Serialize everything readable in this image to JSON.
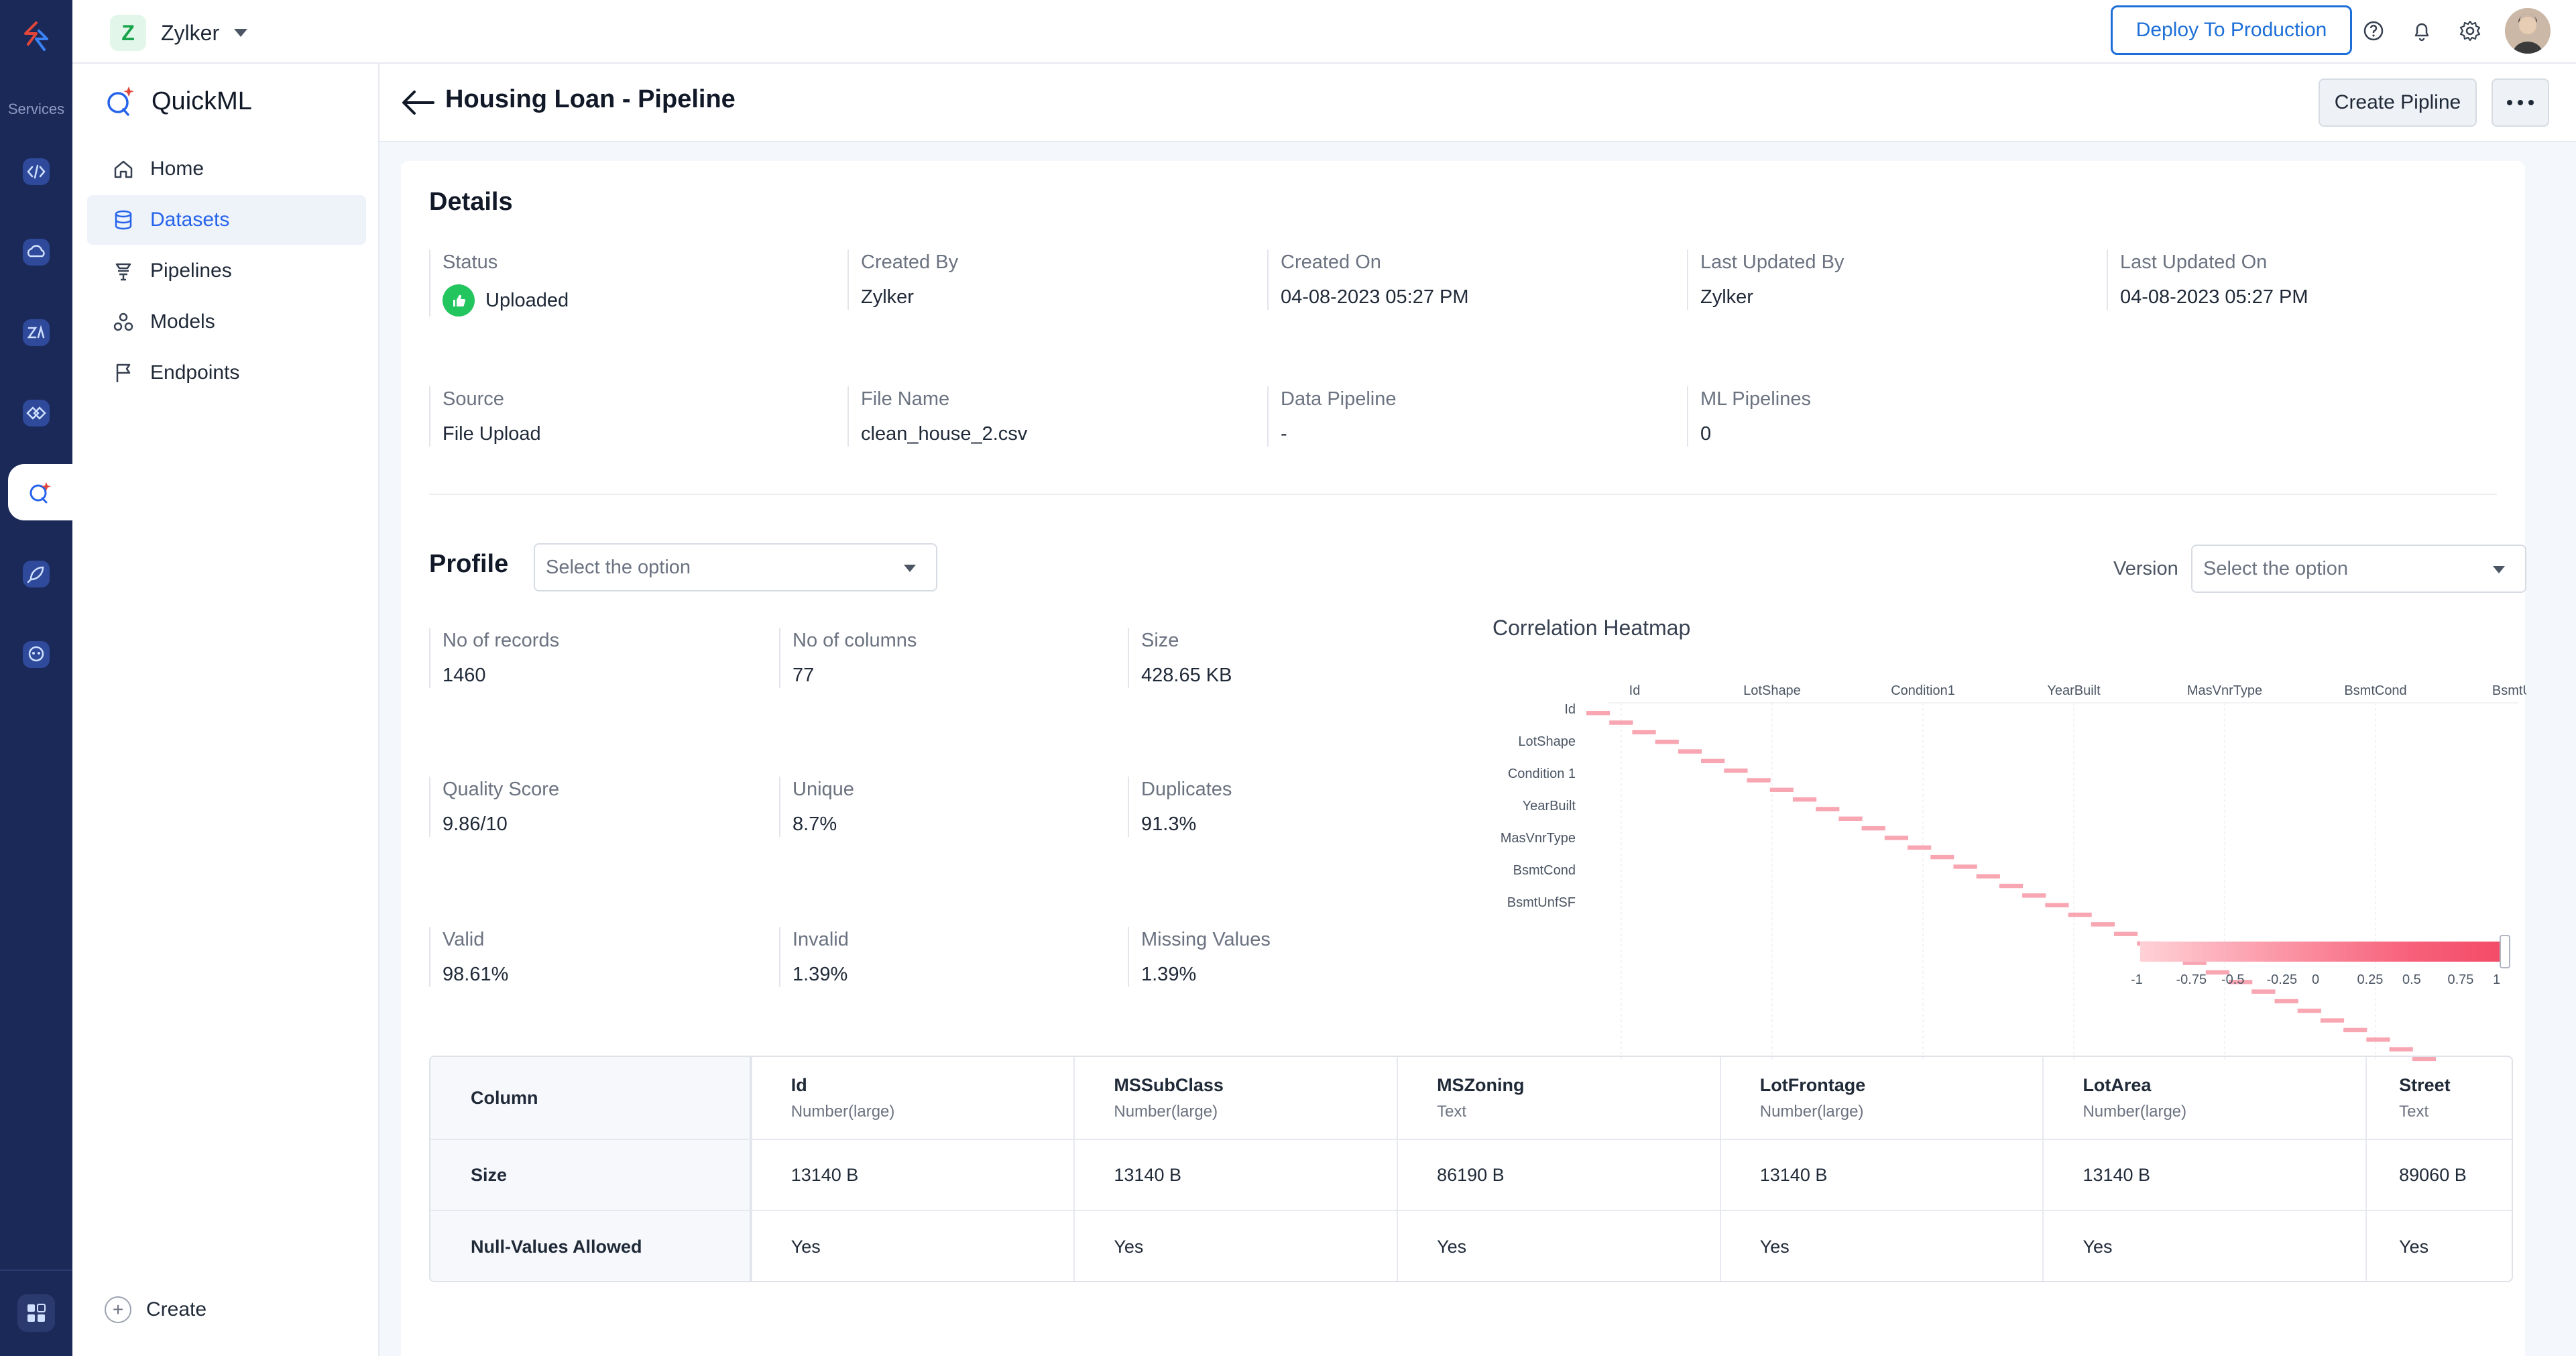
{
  "topbar": {
    "org_initial": "Z",
    "org_name": "Zylker",
    "deploy_label": "Deploy To Production"
  },
  "rail": {
    "services_label": "Services"
  },
  "nav": {
    "brand": "QuickML",
    "items": [
      {
        "label": "Home",
        "icon": "home-icon"
      },
      {
        "label": "Datasets",
        "icon": "database-icon"
      },
      {
        "label": "Pipelines",
        "icon": "pipeline-icon"
      },
      {
        "label": "Models",
        "icon": "models-icon"
      },
      {
        "label": "Endpoints",
        "icon": "flag-icon"
      }
    ],
    "create_label": "Create"
  },
  "page": {
    "title": "Housing Loan - Pipeline",
    "create_pipeline_label": "Create Pipline"
  },
  "details": {
    "heading": "Details",
    "status_label": "Status",
    "status_value": "Uploaded",
    "created_by_label": "Created By",
    "created_by_value": "Zylker",
    "created_on_label": "Created On",
    "created_on_value": "04-08-2023 05:27 PM",
    "last_updated_by_label": "Last Updated By",
    "last_updated_by_value": "Zylker",
    "last_updated_on_label": "Last Updated On",
    "last_updated_on_value": "04-08-2023 05:27 PM",
    "source_label": "Source",
    "source_value": "File Upload",
    "file_name_label": "File Name",
    "file_name_value": "clean_house_2.csv",
    "data_pipeline_label": "Data Pipeline",
    "data_pipeline_value": "-",
    "ml_pipelines_label": "ML Pipelines",
    "ml_pipelines_value": "0"
  },
  "profile": {
    "heading": "Profile",
    "select_placeholder": "Select the option",
    "version_label": "Version",
    "version_placeholder": "Select the option",
    "stats": {
      "records_label": "No of records",
      "records_value": "1460",
      "columns_label": "No of columns",
      "columns_value": "77",
      "size_label": "Size",
      "size_value": "428.65 KB",
      "quality_label": "Quality Score",
      "quality_value": "9.86/10",
      "unique_label": "Unique",
      "unique_value": "8.7%",
      "duplicates_label": "Duplicates",
      "duplicates_value": "91.3%",
      "valid_label": "Valid",
      "valid_value": "98.61%",
      "invalid_label": "Invalid",
      "invalid_value": "1.39%",
      "missing_label": "Missing Values",
      "missing_value": "1.39%"
    }
  },
  "heatmap": {
    "title": "Correlation Heatmap",
    "x_labels": [
      "Id",
      "LotShape",
      "Condition1",
      "YearBuilt",
      "MasVnrType",
      "BsmtCond",
      "BsmtUnfSF"
    ],
    "y_labels": [
      "Id",
      "LotShape",
      "Condition 1",
      "YearBuilt",
      "MasVnrType",
      "BsmtCond",
      "BsmtUnfSF"
    ],
    "legend_ticks": [
      "-1",
      "-0.75",
      "-0.5",
      "-0.25",
      "0",
      "0.25",
      "0.5",
      "0.75",
      "1"
    ],
    "diagonal_cells": 37,
    "cell_color": "#f8a6b2"
  },
  "columns_table": {
    "row_headers": {
      "column": "Column",
      "size": "Size",
      "null": "Null-Values Allowed"
    },
    "columns": [
      {
        "name": "Id",
        "type": "Number(large)",
        "size": "13140 B",
        "null": "Yes"
      },
      {
        "name": "MSSubClass",
        "type": "Number(large)",
        "size": "13140 B",
        "null": "Yes"
      },
      {
        "name": "MSZoning",
        "type": "Text",
        "size": "86190 B",
        "null": "Yes"
      },
      {
        "name": "LotFrontage",
        "type": "Number(large)",
        "size": "13140 B",
        "null": "Yes"
      },
      {
        "name": "LotArea",
        "type": "Number(large)",
        "size": "13140 B",
        "null": "Yes"
      },
      {
        "name": "Street",
        "type": "Text",
        "size": "89060 B",
        "null": "Yes"
      }
    ]
  },
  "colors": {
    "rail": "#1b2959",
    "accent": "#1d6fd8",
    "success": "#22c55e"
  }
}
